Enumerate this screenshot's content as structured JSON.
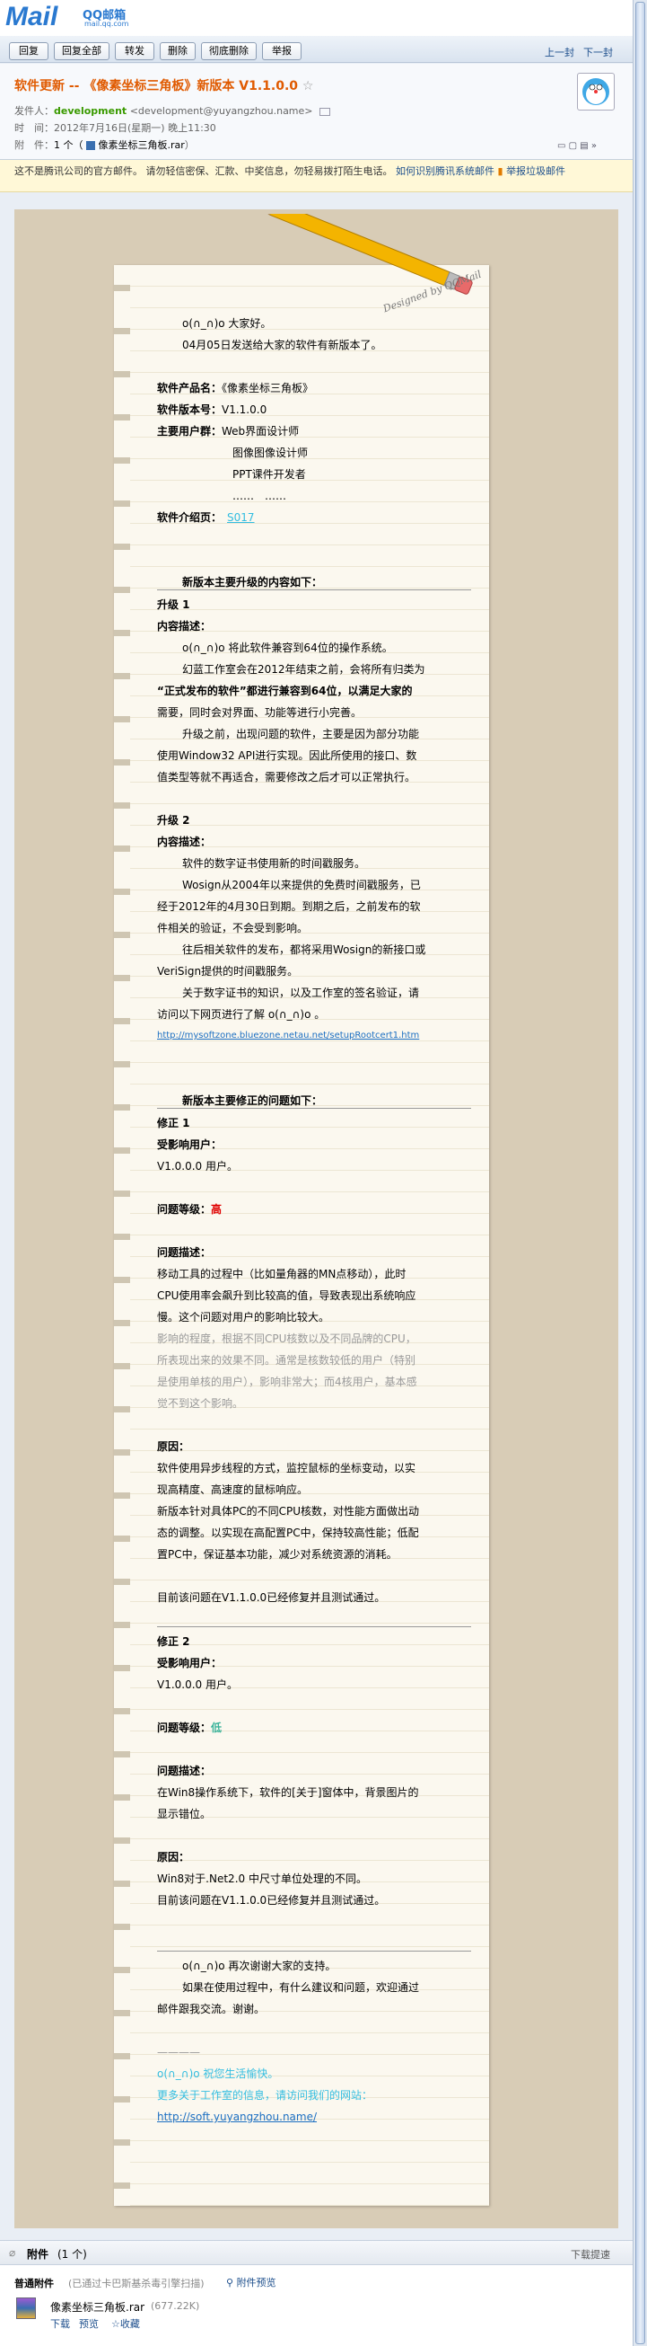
{
  "logo": {
    "brand": "Mail",
    "o_char": "o",
    "qq_label": "QQ邮箱",
    "domain": "mail.qq.com"
  },
  "toolbar": {
    "buttons": [
      "回复",
      "回复全部",
      "转发",
      "删除",
      "彻底删除",
      "举报"
    ],
    "prev": "上一封",
    "next": "下一封"
  },
  "header": {
    "subject": "软件更新 -- 《像素坐标三角板》新版本 V1.1.0.0",
    "star": "☆",
    "sender_label": "发件人：",
    "sender_name": "development",
    "sender_email": "<development@yuyangzhou.name>",
    "time_label": "时　间：",
    "time": "2012年7月16日(星期一) 晚上11:30",
    "attach_label": "附　件：",
    "attach_count": "1 个（",
    "attach_name": "像素坐标三角板.rar",
    "attach_close": "）"
  },
  "warning": {
    "text": "这不是腾讯公司的官方邮件。 请勿轻信密保、汇款、中奖信息，勿轻易拨打陌生电话。",
    "link": "如何识别腾讯系统邮件",
    "report": "举报垃圾邮件"
  },
  "paper": {
    "stamp": "Designed by QQMail"
  },
  "email": {
    "greeting": "o(∩_∩)o  大家好。",
    "intro": "04月05日发送给大家的软件有新版本了。",
    "product_label": "软件产品名：",
    "product_value": "《像素坐标三角板》",
    "version_label": "软件版本号：",
    "version_value": "V1.1.0.0",
    "users_label": "主要用户群：",
    "users": [
      "Web界面设计师",
      "图像图像设计师",
      "PPT课件开发者",
      "……　……"
    ],
    "intro_page_label": "软件介绍页：",
    "intro_page_link": "S017",
    "upgrade_heading": "新版本主要升级的内容如下：",
    "upgrade1_title": "升级 1",
    "content_label": "内容描述：",
    "upgrade1_lines": [
      "o(∩_∩)o  将此软件兼容到64位的操作系统。",
      "幻蓝工作室会在2012年结束之前，会将所有归类为",
      "“正式发布的软件”都进行兼容到64位，以满足大家的",
      "需要，同时会对界面、功能等进行小完善。",
      "升级之前，出现问题的软件，主要是因为部分功能",
      "使用Window32 API进行实现。因此所使用的接口、数",
      "值类型等就不再适合，需要修改之后才可以正常执行。"
    ],
    "upgrade2_title": "升级 2",
    "upgrade2_lines": [
      "软件的数字证书使用新的时间戳服务。",
      "Wosign从2004年以来提供的免费时间戳服务，已",
      "经于2012年的4月30日到期。到期之后，之前发布的软",
      "件相关的验证，不会受到影响。",
      "往后相关软件的发布，都将采用Wosign的新接口或",
      "VeriSign提供的时间戳服务。",
      "关于数字证书的知识，以及工作室的签名验证，请",
      "访问以下网页进行了解  o(∩_∩)o 。"
    ],
    "upgrade2_url": "http://mysoftzone.bluezone.netau.net/setupRootcert1.htm",
    "fix_heading": "新版本主要修正的问题如下：",
    "fix1_title": "修正 1",
    "affected_label": "受影响用户：",
    "fix1_affected": "V1.0.0.0  用户。",
    "level_label": "问题等级：",
    "fix1_level": "高",
    "problem_label": "问题描述：",
    "fix1_problem": [
      "移动工具的过程中（比如量角器的MN点移动），此时",
      "CPU使用率会飙升到比较高的值，导致表现出系统响应",
      "慢。这个问题对用户的影响比较大。"
    ],
    "fix1_note": [
      "影响的程度，根据不同CPU核数以及不同品牌的CPU，",
      "所表现出来的效果不同。通常是核数较低的用户（特别",
      "是使用单核的用户），影响非常大；而4核用户，基本感",
      "觉不到这个影响。"
    ],
    "cause_label": "原因：",
    "fix1_cause": [
      "软件使用异步线程的方式，监控鼠标的坐标变动，以实",
      "现高精度、高速度的鼠标响应。",
      "新版本针对具体PC的不同CPU核数，对性能方面做出动",
      "态的调整。以实现在高配置PC中，保持较高性能；低配",
      "置PC中，保证基本功能，减少对系统资源的消耗。"
    ],
    "fix1_status": "目前该问题在V1.1.0.0已经修复并且测试通过。",
    "fix2_title": "修正 2",
    "fix2_affected": "V1.0.0.0 用户。",
    "fix2_level": "低",
    "fix2_problem": [
      "在Win8操作系统下，软件的[关于]窗体中，背景图片的",
      "显示错位。"
    ],
    "fix2_cause": "Win8对于.Net2.0 中尺寸单位处理的不同。",
    "fix2_status": "目前该问题在V1.1.0.0已经修复并且测试通过。",
    "closing1": "o(∩_∩)o 再次谢谢大家的支持。",
    "closing2": "如果在使用过程中，有什么建议和问题，欢迎通过",
    "closing3": "邮件跟我交流。谢谢。",
    "sig_dash": "————",
    "sig1": "o(∩_∩)o  祝您生活愉快。",
    "sig2": "更多关于工作室的信息，请访问我们的网站：",
    "sig_url": "http://soft.yuyangzhou.name/"
  },
  "attachments": {
    "title": "附件",
    "count": "(1 个)",
    "download_tip": "下载提速",
    "section": "普通附件",
    "scan_note": "(已通过卡巴斯基杀毒引擎扫描)",
    "preview_all": "附件预览",
    "file_name": "像素坐标三角板.rar",
    "file_size": "(677.22K)",
    "actions": [
      "下载",
      "预览",
      "收藏"
    ]
  },
  "colors": {
    "subject": "#e05a00",
    "sender": "#3a9a00",
    "high": "#e00000",
    "low": "#3ab39a",
    "link": "#1c6fc2"
  }
}
